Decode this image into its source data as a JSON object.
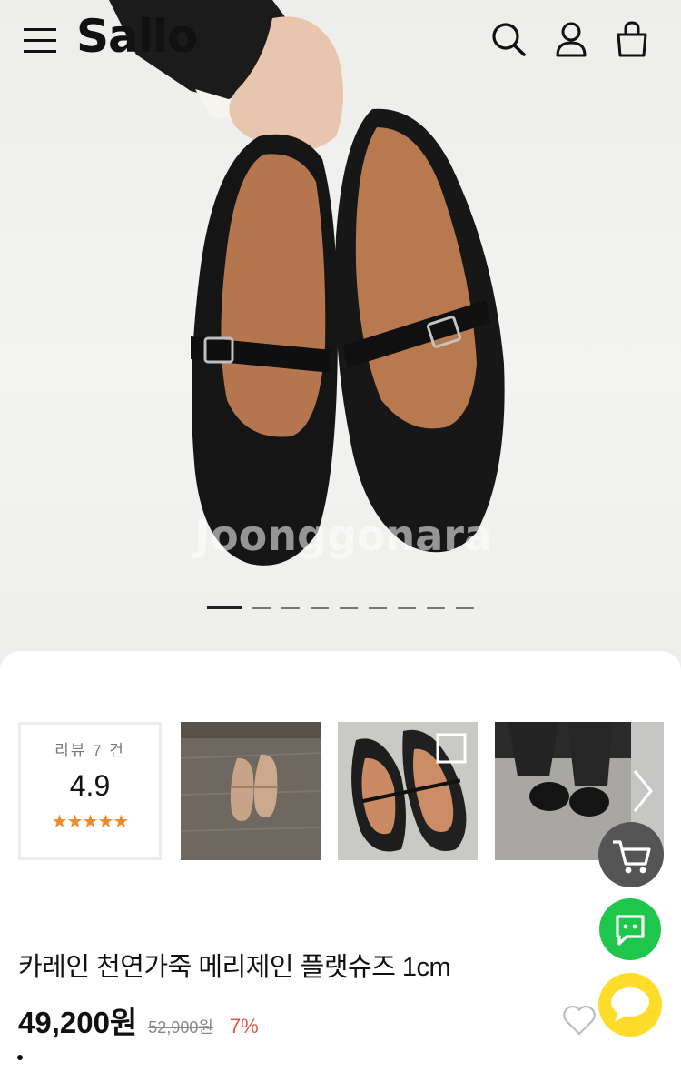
{
  "header": {
    "brand": "Sallo",
    "menu_icon": "hamburger-menu-icon",
    "search_icon": "search-icon",
    "user_icon": "user-icon",
    "bag_icon": "shopping-bag-icon"
  },
  "gallery": {
    "slide_count": 10,
    "active_index": 0,
    "watermark": "Joonggonara",
    "watermark_url": "cafe.naver.com/joonggonara"
  },
  "review": {
    "label": "리뷰 7 건",
    "score": "4.9",
    "stars": "★★★★★"
  },
  "product": {
    "title": "카레인 천연가죽 메리제인 플랫슈즈 1cm",
    "price": "49,200원",
    "original_price": "52,900원",
    "discount": "7%"
  },
  "colors": {
    "star": "#f08a24",
    "discount": "#e05548",
    "talk_green": "#1ec74b",
    "chat_yellow": "#fedc2a",
    "cart_gray": "#555555"
  }
}
